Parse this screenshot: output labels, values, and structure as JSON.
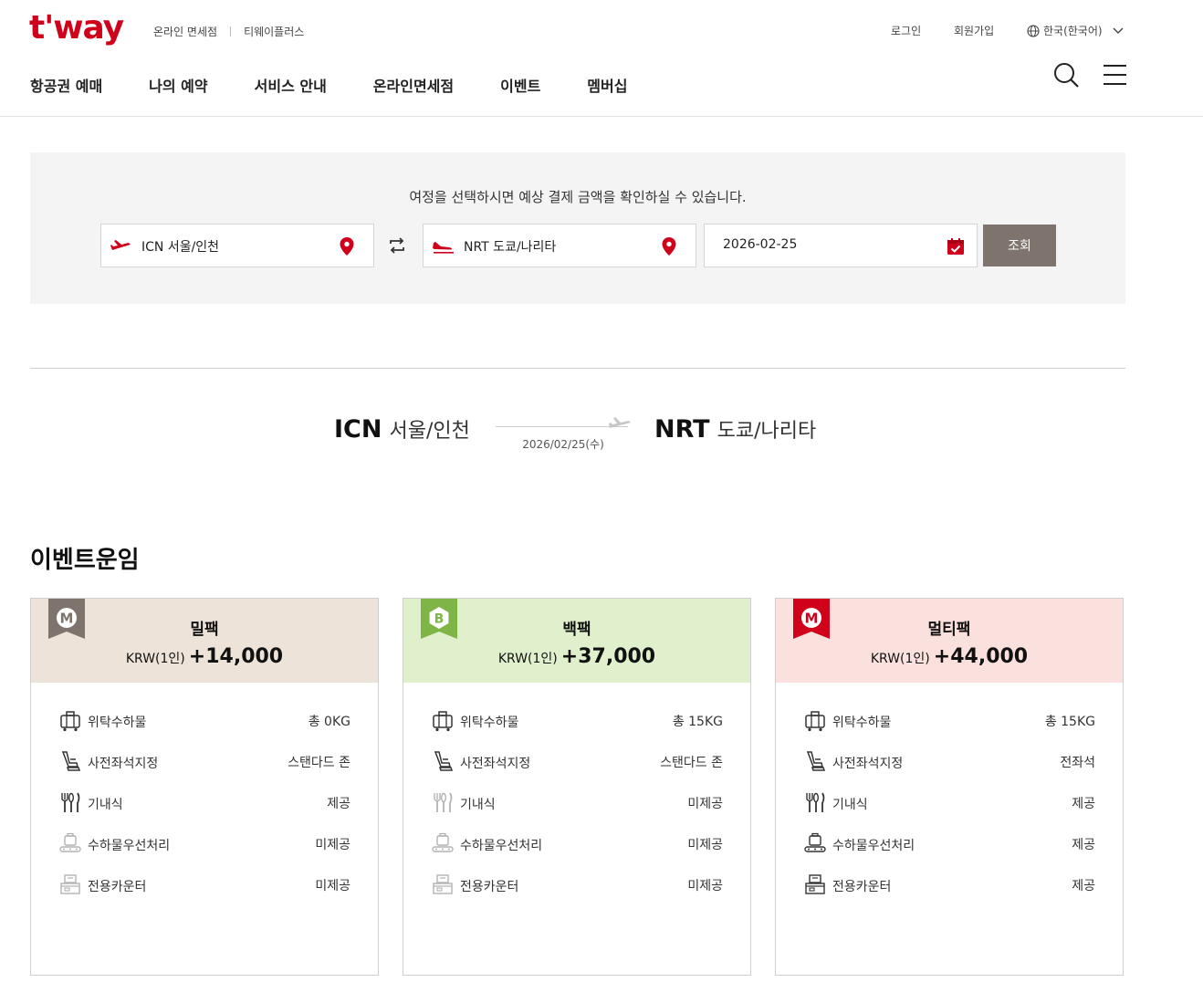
{
  "header": {
    "logo": "t'way",
    "top_links": [
      "온라인 면세점",
      "티웨이플러스"
    ],
    "login": "로그인",
    "join": "회원가입",
    "language": "한국(한국어)",
    "nav": [
      "항공권 예매",
      "나의 예약",
      "서비스 안내",
      "온라인면세점",
      "이벤트",
      "멤버십"
    ]
  },
  "search": {
    "guide": "여정을 선택하시면 예상 결제 금액을 확인하실 수 있습니다.",
    "departure": "ICN 서울/인천",
    "arrival": "NRT 도쿄/나리타",
    "date": "2026-02-25",
    "button": "조회"
  },
  "route": {
    "from_code": "ICN",
    "from_city": "서울/인천",
    "to_code": "NRT",
    "to_city": "도쿄/나리타",
    "date": "2026/02/25(수)"
  },
  "section_title": "이벤트운임",
  "colors": {
    "brand_red": "#d0021b",
    "search_button": "#7f746d",
    "meal_head": "#ede3d9",
    "bag_head": "#e0efcc",
    "multi_head": "#fbe1dd"
  },
  "cards": [
    {
      "name": "밀팩",
      "badge": "M",
      "currency": "KRW(1인)",
      "price": "+14,000",
      "benefits": [
        {
          "icon": "luggage-icon",
          "label": "위탁수하물",
          "value": "총 0KG"
        },
        {
          "icon": "seat-icon",
          "label": "사전좌석지정",
          "value": "스탠다드 존"
        },
        {
          "icon": "meal-icon",
          "label": "기내식",
          "value": "제공"
        },
        {
          "icon": "priority-baggage-icon",
          "label": "수하물우선처리",
          "value": "미제공"
        },
        {
          "icon": "counter-icon",
          "label": "전용카운터",
          "value": "미제공"
        }
      ]
    },
    {
      "name": "백팩",
      "badge": "B",
      "currency": "KRW(1인)",
      "price": "+37,000",
      "benefits": [
        {
          "icon": "luggage-icon",
          "label": "위탁수하물",
          "value": "총 15KG"
        },
        {
          "icon": "seat-icon",
          "label": "사전좌석지정",
          "value": "스탠다드 존"
        },
        {
          "icon": "meal-icon",
          "label": "기내식",
          "value": "미제공"
        },
        {
          "icon": "priority-baggage-icon",
          "label": "수하물우선처리",
          "value": "미제공"
        },
        {
          "icon": "counter-icon",
          "label": "전용카운터",
          "value": "미제공"
        }
      ]
    },
    {
      "name": "멀티팩",
      "badge": "M",
      "currency": "KRW(1인)",
      "price": "+44,000",
      "benefits": [
        {
          "icon": "luggage-icon",
          "label": "위탁수하물",
          "value": "총 15KG"
        },
        {
          "icon": "seat-icon",
          "label": "사전좌석지정",
          "value": "전좌석"
        },
        {
          "icon": "meal-icon",
          "label": "기내식",
          "value": "제공"
        },
        {
          "icon": "priority-baggage-icon",
          "label": "수하물우선처리",
          "value": "제공"
        },
        {
          "icon": "counter-icon",
          "label": "전용카운터",
          "value": "제공"
        }
      ]
    }
  ]
}
